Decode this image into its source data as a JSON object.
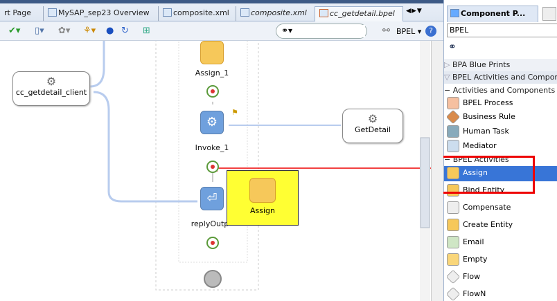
{
  "tabs": [
    {
      "label": "rt Page"
    },
    {
      "label": "MySAP_sep23 Overview"
    },
    {
      "label": "composite.xml"
    },
    {
      "label": "composite.xml"
    },
    {
      "label": "cc_getdetail.bpel"
    }
  ],
  "toolbar": {
    "search_value": "",
    "mode_label": "BPEL"
  },
  "canvas": {
    "client": "cc_getdetail_client",
    "assign1": "Assign_1",
    "invoke1": "Invoke_1",
    "getdetail": "GetDetail",
    "reply": "replyOutp",
    "drag_label": "Assign"
  },
  "palette": {
    "title": "Component P...",
    "dropdown": "BPEL",
    "search_value": "",
    "groups": [
      "BPA Blue Prints",
      "BPEL Activities and Components"
    ],
    "sections": [
      "Activities and Components",
      "BPEL Activities"
    ],
    "components": [
      "BPEL Process",
      "Business Rule",
      "Human Task",
      "Mediator"
    ],
    "activities": [
      "Assign",
      "Bind Entity",
      "Compensate",
      "Create Entity",
      "Email",
      "Empty",
      "Flow",
      "FlowN"
    ],
    "selected": "Assign"
  },
  "colors": {
    "highlight": "#ff0000",
    "selected": "#3875d7",
    "drag_bg": "#ffff33"
  }
}
